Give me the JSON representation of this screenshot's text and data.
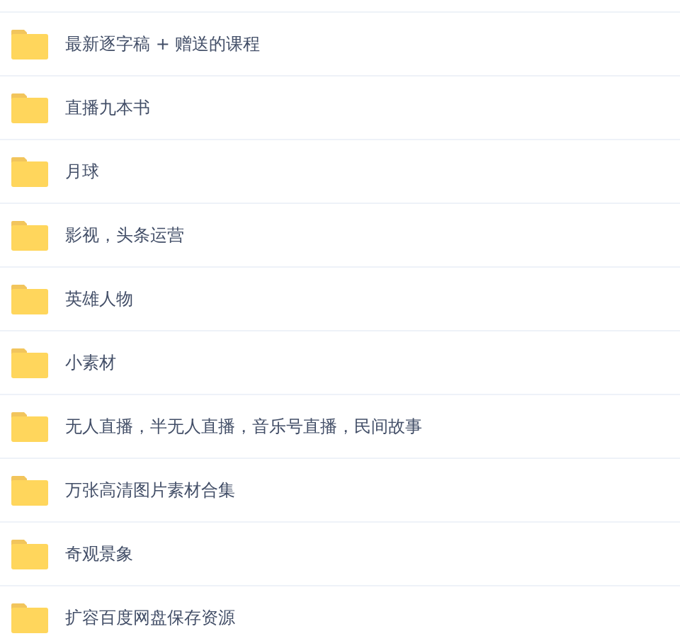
{
  "folders": [
    {
      "name": "最新逐字稿 + 赠送的课程"
    },
    {
      "name": "直播九本书"
    },
    {
      "name": "月球"
    },
    {
      "name": "影视，头条运营"
    },
    {
      "name": "英雄人物"
    },
    {
      "name": "小素材"
    },
    {
      "name": "无人直播，半无人直播，音乐号直播，民间故事"
    },
    {
      "name": "万张高清图片素材合集"
    },
    {
      "name": "奇观景象"
    },
    {
      "name": "扩容百度网盘保存资源"
    }
  ]
}
